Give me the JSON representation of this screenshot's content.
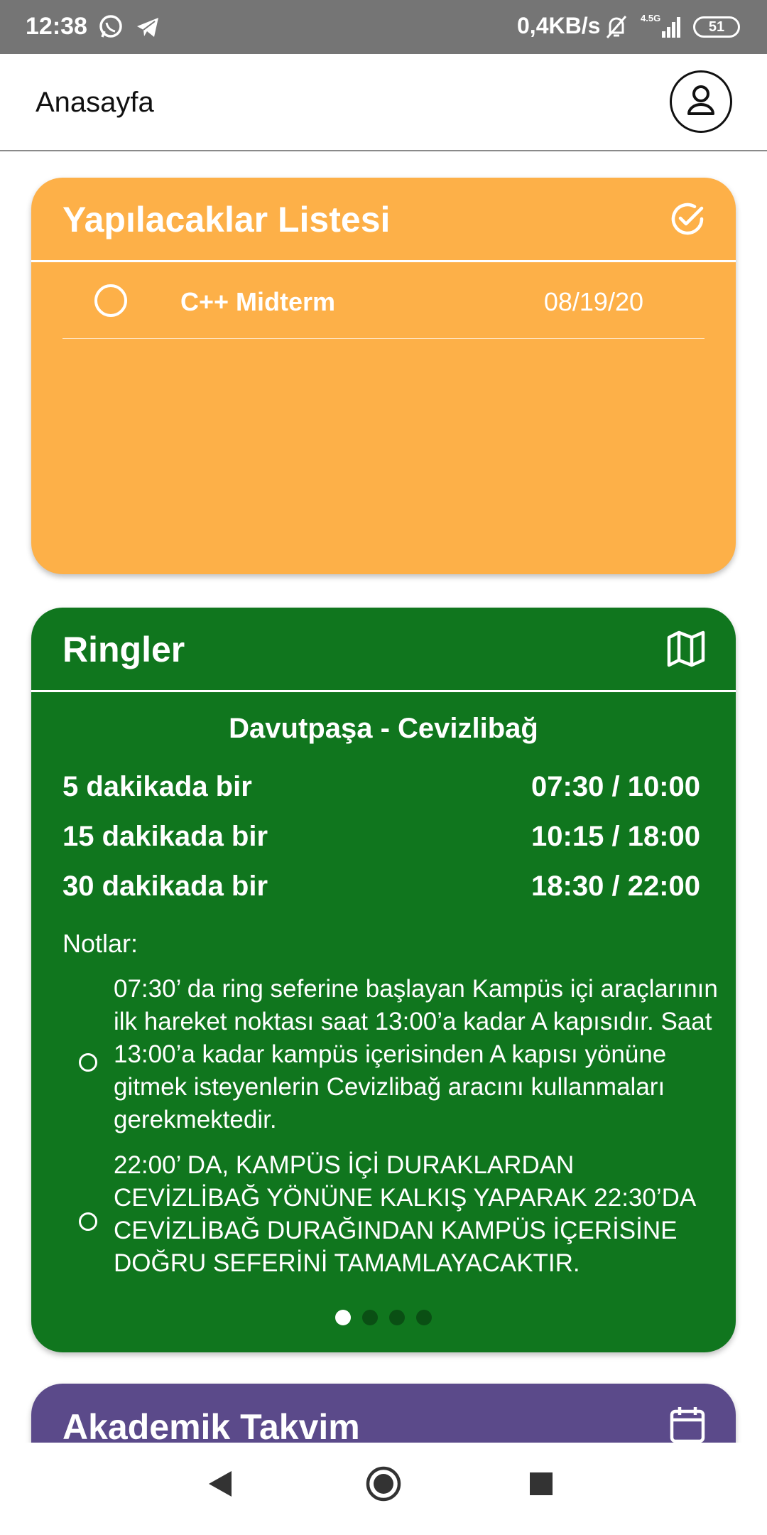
{
  "status_bar": {
    "time": "12:38",
    "network_speed": "0,4KB/s",
    "network_type": "4.5G",
    "battery": "51",
    "icons": [
      "whatsapp-icon",
      "telegram-icon",
      "mute-bell-icon",
      "signal-icon",
      "battery-icon"
    ]
  },
  "app_bar": {
    "title": "Anasayfa",
    "profile_icon": "person-icon"
  },
  "todo_card": {
    "title": "Yapılacaklar Listesi",
    "icon": "check-circle-icon",
    "color": "#fdb048",
    "items": [
      {
        "text": "C++ Midterm",
        "date": "08/19/20",
        "done": false
      }
    ]
  },
  "ring_card": {
    "title": "Ringler",
    "icon": "map-icon",
    "color": "#10761e",
    "route": "Davutpaşa - Cevizlibağ",
    "schedule": [
      {
        "frequency": "5 dakikada bir",
        "times": "07:30 / 10:00"
      },
      {
        "frequency": "15 dakikada bir",
        "times": "10:15 / 18:00"
      },
      {
        "frequency": "30 dakikada bir",
        "times": "18:30 / 22:00"
      }
    ],
    "notes_label": "Notlar:",
    "notes": [
      "07:30’ da ring seferine başlayan Kampüs içi araçlarının ilk hareket noktası saat 13:00’a kadar A kapısıdır. Saat 13:00’a kadar kampüs içerisinden A kapısı yönüne gitmek isteyenlerin Cevizlibağ aracını kullanmaları gerekmektedir.",
      "22:00’ DA, KAMPÜS İÇİ DURAKLARDAN CEVİZLİBAĞ YÖNÜNE KALKIŞ YAPARAK 22:30’DA CEVİZLİBAĞ DURAĞINDAN  KAMPÜS İÇERİSİNE DOĞRU SEFERİNİ TAMAMLAYACAKTIR."
    ],
    "page_count": 4,
    "current_page": 1
  },
  "calendar_card": {
    "title": "Akademik Takvim",
    "icon": "calendar-icon",
    "color": "#5b4a8a"
  },
  "nav_bar": {
    "buttons": [
      "back-icon",
      "home-icon",
      "recents-icon"
    ]
  }
}
